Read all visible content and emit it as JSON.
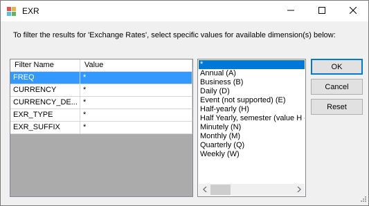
{
  "window": {
    "title": "EXR",
    "icons": {
      "app": "app-icon",
      "minimize": "minimize-icon",
      "maximize": "maximize-icon",
      "close": "close-icon"
    }
  },
  "instruction": "To filter the results for 'Exchange Rates', select specific values for available dimension(s) below:",
  "grid": {
    "headers": {
      "name": "Filter Name",
      "value": "Value"
    },
    "rows": [
      {
        "name": "FREQ",
        "value": "*",
        "selected": true
      },
      {
        "name": "CURRENCY",
        "value": "*"
      },
      {
        "name": "CURRENCY_DE...",
        "value": "*"
      },
      {
        "name": "EXR_TYPE",
        "value": "*"
      },
      {
        "name": "EXR_SUFFIX",
        "value": "*"
      }
    ]
  },
  "values_list": {
    "items": [
      "*",
      "Annual (A)",
      "Business (B)",
      "Daily (D)",
      "Event (not supported) (E)",
      "Half-yearly (H)",
      "Half Yearly, semester (value H e...",
      "Minutely (N)",
      "Monthly (M)",
      "Quarterly (Q)",
      "Weekly (W)"
    ],
    "selected_index": 0
  },
  "buttons": {
    "ok": "OK",
    "cancel": "Cancel",
    "reset": "Reset"
  },
  "colors": {
    "selection": "#3399ff",
    "list_selection": "#0078d7",
    "grid_background": "#ababab"
  }
}
